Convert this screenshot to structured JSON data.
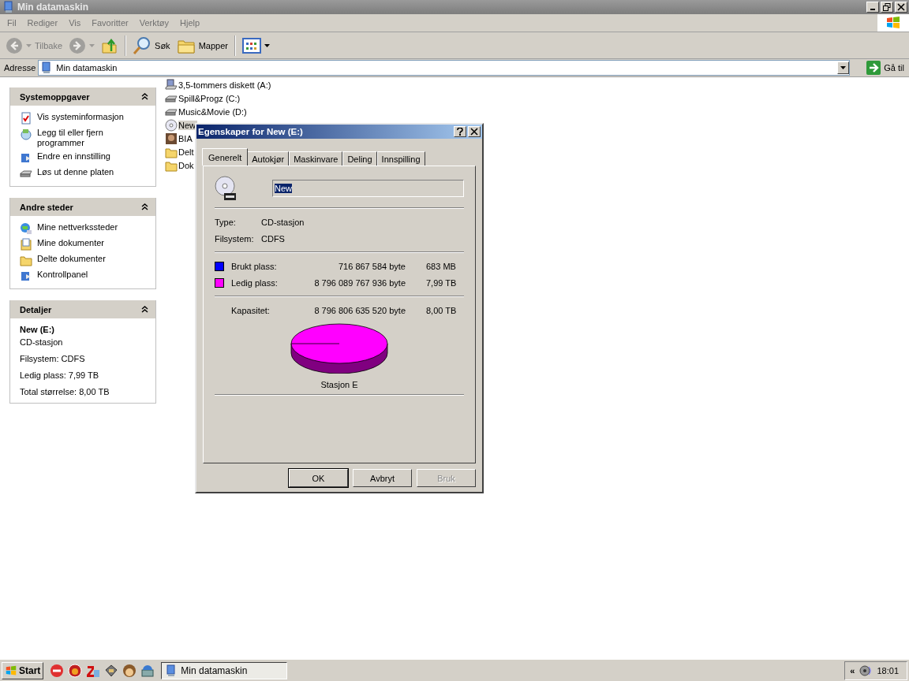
{
  "window": {
    "title": "Min datamaskin"
  },
  "menu": [
    "Fil",
    "Rediger",
    "Vis",
    "Favoritter",
    "Verktøy",
    "Hjelp"
  ],
  "toolbar": [
    {
      "kind": "back",
      "label": "Tilbake",
      "disabled": true
    },
    {
      "kind": "forward",
      "disabled": true
    },
    {
      "kind": "up",
      "disabled": false
    },
    {
      "kind": "search",
      "label": "Søk",
      "disabled": false
    },
    {
      "kind": "folders",
      "label": "Mapper",
      "disabled": false
    },
    {
      "kind": "views",
      "disabled": false
    }
  ],
  "address": {
    "label": "Adresse",
    "value": "Min datamaskin",
    "go": "Gå til"
  },
  "sidebar": [
    {
      "kind": "links",
      "title": "Systemoppgaver",
      "items": [
        {
          "kind": "info",
          "label": "Vis systeminformasjon"
        },
        {
          "kind": "programs",
          "label": "Legg til eller fjern programmer"
        },
        {
          "kind": "settings",
          "label": "Endre en innstilling"
        },
        {
          "kind": "drive",
          "label": "Løs ut denne platen"
        }
      ]
    },
    {
      "kind": "links",
      "title": "Andre steder",
      "items": [
        {
          "kind": "network",
          "label": "Mine nettverkssteder"
        },
        {
          "kind": "documents",
          "label": "Mine dokumenter"
        },
        {
          "kind": "folder",
          "label": "Delte dokumenter"
        },
        {
          "kind": "settings",
          "label": "Kontrollpanel"
        }
      ]
    },
    {
      "kind": "details",
      "title": "Detaljer",
      "name": "New (E:)",
      "lines": [
        "CD-stasjon",
        "Filsystem: CDFS",
        "Ledig plass: 7,99 TB",
        "Total størrelse: 8,00 TB"
      ]
    }
  ],
  "drives": [
    {
      "kind": "floppy",
      "label": "3,5-tommers diskett (A:)",
      "selected": false
    },
    {
      "kind": "drive",
      "label": "Spill&Progz (C:)",
      "selected": false
    },
    {
      "kind": "drive",
      "label": "Music&Movie (D:)",
      "selected": false
    },
    {
      "kind": "cd",
      "label": "New",
      "selected": true
    },
    {
      "label": "BIA",
      "selected": false
    },
    {
      "kind": "folder",
      "label": "Delt",
      "selected": false
    },
    {
      "kind": "folder",
      "label": "Dok",
      "selected": false
    }
  ],
  "dialog": {
    "title": "Egenskaper for New (E:)",
    "tabs": [
      {
        "label": "Generelt",
        "selected": true
      },
      {
        "label": "Autokjør",
        "selected": false
      },
      {
        "label": "Maskinvare",
        "selected": false
      },
      {
        "label": "Deling",
        "selected": false
      },
      {
        "label": "Innspilling",
        "selected": false
      }
    ],
    "name_value": "New",
    "props": [
      {
        "label": "Type:",
        "value": "CD-stasjon"
      },
      {
        "label": "Filsystem:",
        "value": "CDFS"
      }
    ],
    "space": [
      {
        "label": "Brukt plass:",
        "bytes": "716 867 584 byte",
        "size": "683 MB",
        "color": "#0000ff"
      },
      {
        "label": "Ledig plass:",
        "bytes": "8 796 089 767 936 byte",
        "size": "7,99 TB",
        "color": "#ff00ff"
      }
    ],
    "capacity": {
      "label": "Kapasitet:",
      "bytes": "8 796 806 635 520 byte",
      "size": "8,00 TB"
    },
    "drive_label": "Stasjon E",
    "buttons": [
      {
        "label": "OK",
        "disabled": false,
        "default": true
      },
      {
        "label": "Avbryt",
        "disabled": false,
        "default": false
      },
      {
        "label": "Bruk",
        "disabled": true,
        "default": false
      }
    ]
  },
  "taskbar": {
    "start": "Start",
    "task": "Min datamaskin",
    "chevron": "«",
    "time": "18:01"
  }
}
